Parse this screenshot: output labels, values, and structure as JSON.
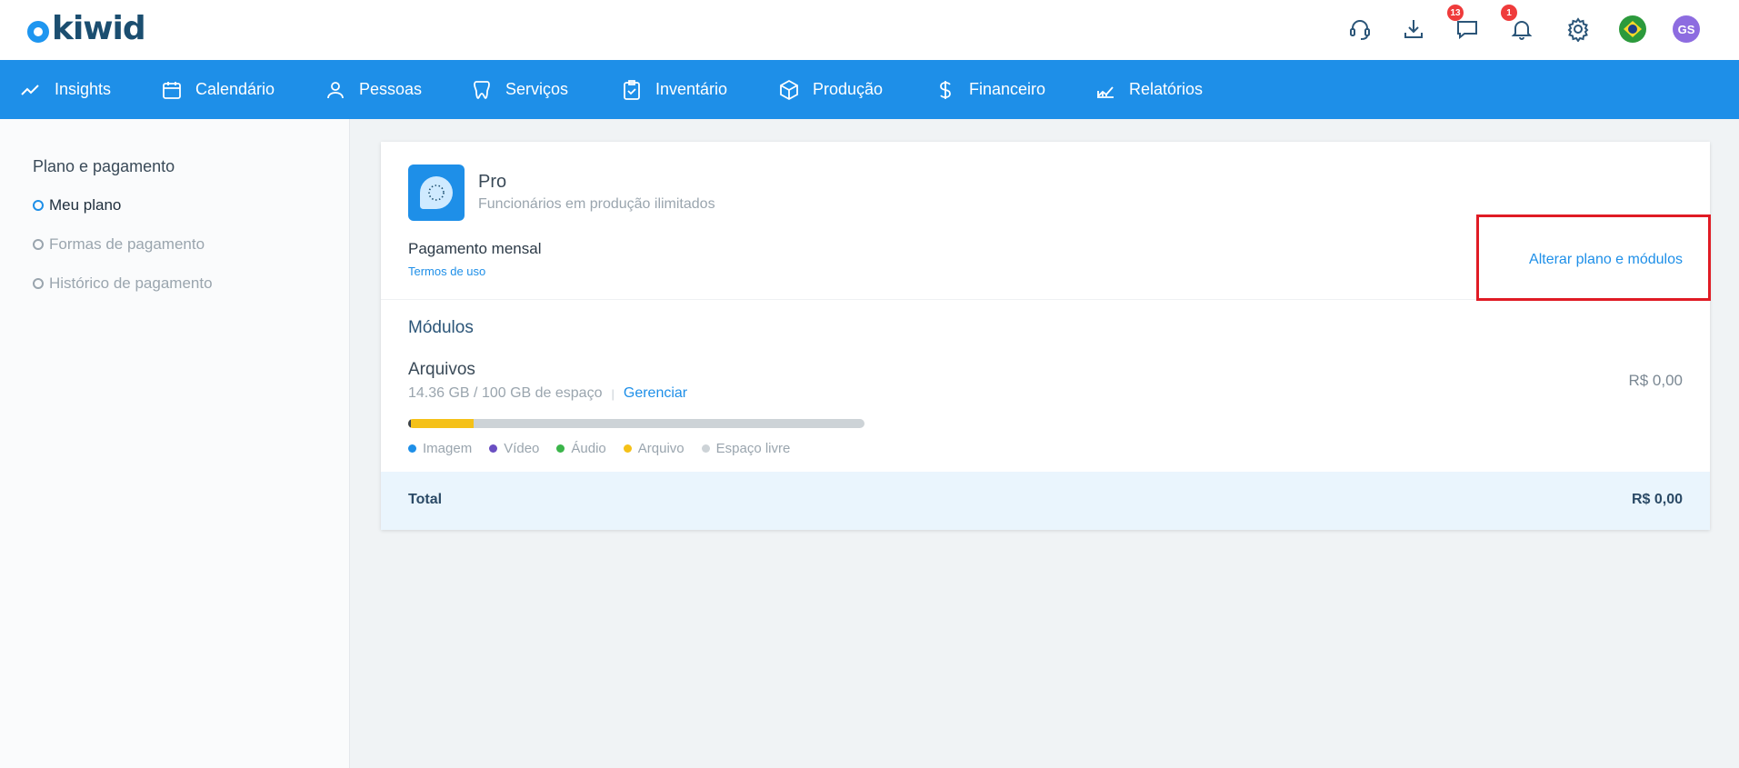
{
  "brand": {
    "logo_text": "kiwid",
    "accent": "#1e8fe8"
  },
  "header": {
    "chat_badge": "13",
    "notification_badge": "1",
    "avatar_initials": "GS",
    "icons": [
      "support-icon",
      "download-icon",
      "chat-icon",
      "bell-icon",
      "gear-icon",
      "brazil-flag-icon"
    ]
  },
  "nav": {
    "items": [
      {
        "label": "Insights",
        "icon": "trend-icon"
      },
      {
        "label": "Calendário",
        "icon": "calendar-icon"
      },
      {
        "label": "Pessoas",
        "icon": "person-icon"
      },
      {
        "label": "Serviços",
        "icon": "tooth-icon"
      },
      {
        "label": "Inventário",
        "icon": "clipboard-icon"
      },
      {
        "label": "Produção",
        "icon": "box-icon"
      },
      {
        "label": "Financeiro",
        "icon": "dollar-icon"
      },
      {
        "label": "Relatórios",
        "icon": "chart-icon"
      }
    ]
  },
  "sidebar": {
    "title": "Plano e pagamento",
    "items": [
      {
        "label": "Meu plano",
        "active": true
      },
      {
        "label": "Formas de pagamento",
        "active": false
      },
      {
        "label": "Histórico de pagamento",
        "active": false
      }
    ]
  },
  "plan": {
    "name": "Pro",
    "description": "Funcionários em produção ilimitados",
    "payment_label": "Pagamento mensal",
    "terms_link": "Termos de uso",
    "change_link": "Alterar plano e módulos"
  },
  "modules": {
    "title": "Módulos",
    "files": {
      "title": "Arquivos",
      "usage": "14.36 GB / 100 GB de espaço",
      "manage_link": "Gerenciar",
      "price": "R$ 0,00",
      "usage_fraction": 0.1436
    },
    "legend": [
      {
        "label": "Imagem",
        "color": "#1e8fe8"
      },
      {
        "label": "Vídeo",
        "color": "#6a4fc2"
      },
      {
        "label": "Áudio",
        "color": "#3bb54a"
      },
      {
        "label": "Arquivo",
        "color": "#f5c118"
      },
      {
        "label": "Espaço livre",
        "color": "#cdd3d7"
      }
    ]
  },
  "total": {
    "label": "Total",
    "value": "R$ 0,00"
  }
}
